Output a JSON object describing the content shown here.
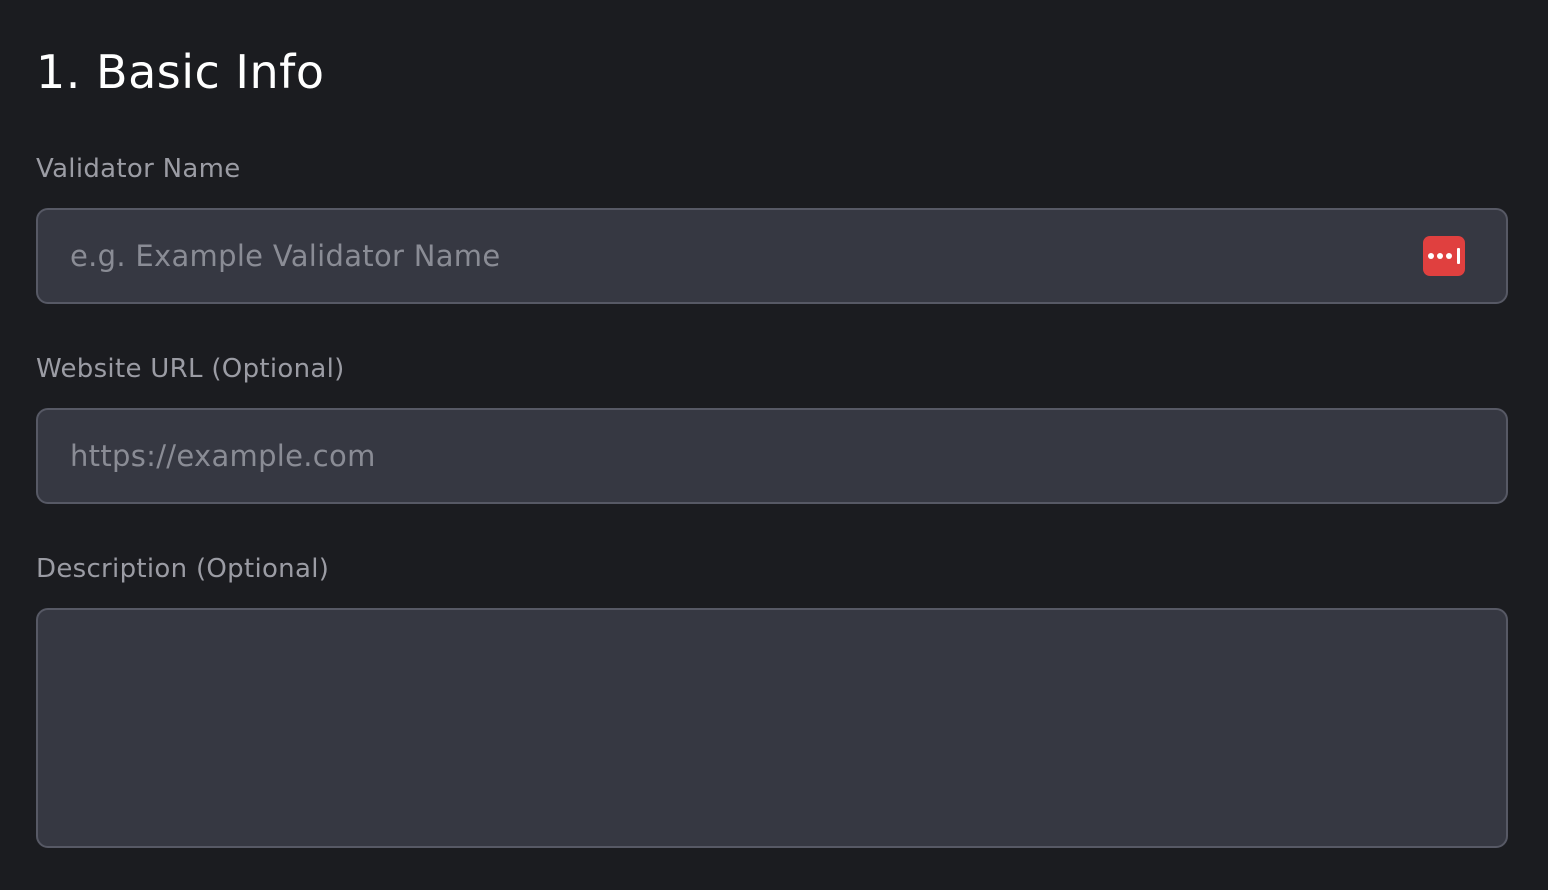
{
  "section": {
    "title": "1. Basic Info"
  },
  "fields": {
    "validator_name": {
      "label": "Validator Name",
      "placeholder": "e.g. Example Validator Name",
      "value": "",
      "icon": "password-manager-icon"
    },
    "website_url": {
      "label": "Website URL (Optional)",
      "placeholder": "https://example.com",
      "value": ""
    },
    "description": {
      "label": "Description (Optional)",
      "placeholder": "",
      "value": ""
    }
  },
  "colors": {
    "background": "#1b1c20",
    "input_background": "#363842",
    "input_border": "#575965",
    "label": "#9b9ca4",
    "title": "#ffffff",
    "icon_accent": "#e0403f"
  }
}
